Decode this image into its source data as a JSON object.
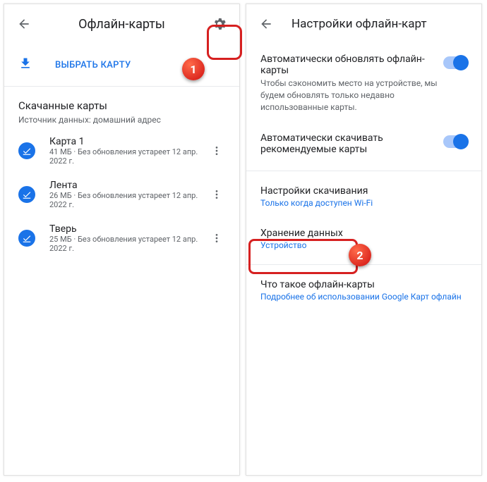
{
  "left": {
    "title": "Офлайн-карты",
    "selectMap": "ВЫБРАТЬ КАРТУ",
    "downloaded": {
      "title": "Скачанные карты",
      "subtitle": "Источник данных: домашний адрес"
    },
    "maps": [
      {
        "name": "Карта 1",
        "detail": "41 МБ · Без обновления устареет 12 апр. 2022 г."
      },
      {
        "name": "Лента",
        "detail": "26 МБ · Без обновления устареет 12 апр. 2022 г."
      },
      {
        "name": "Тверь",
        "detail": "25 МБ · Без обновления устареет 12 апр. 2022 г."
      }
    ]
  },
  "right": {
    "title": "Настройки офлайн-карт",
    "autoUpdate": {
      "title": "Автоматически обновлять офлайн-карты",
      "sub": "Чтобы сэкономить место на устройстве, мы будем обновлять только недавно использованные карты."
    },
    "autoDownload": {
      "title": "Автоматически скачивать рекомендуемые карты"
    },
    "download": {
      "title": "Настройки скачивания",
      "sub": "Только когда доступен Wi-Fi"
    },
    "storage": {
      "title": "Хранение данных",
      "sub": "Устройство"
    },
    "about": {
      "title": "Что такое офлайн-карты",
      "sub": "Подробнее об использовании Google Карт офлайн"
    }
  },
  "callouts": {
    "one": "1",
    "two": "2"
  }
}
